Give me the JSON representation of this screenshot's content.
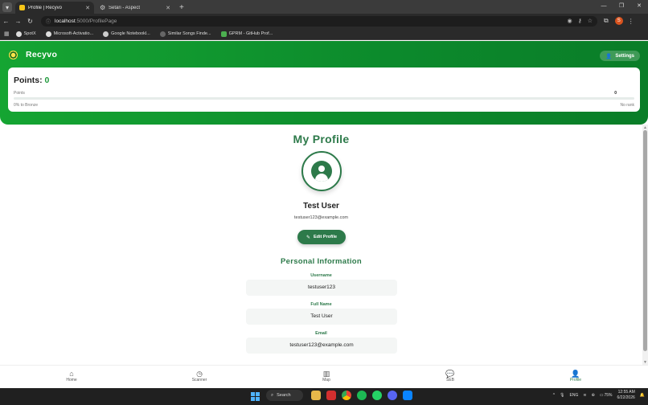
{
  "browser": {
    "tabs": [
      {
        "title": "Profile | Recyvo",
        "active": true
      },
      {
        "title": "Setári - Aspect",
        "active": false
      }
    ],
    "url_host": "localhost",
    "url_path": ":5000/ProfilePage",
    "bookmarks": [
      "SpotX",
      "Microsoft-Activatio...",
      "Google Notebookl...",
      "Similar Songs Finde...",
      "GPRM - GitHub Prof..."
    ],
    "profile_badge": "S"
  },
  "header": {
    "brand": "Recyvo",
    "settings_label": "Settings"
  },
  "points": {
    "title_label": "Points:",
    "value": "0",
    "row_label": "Points",
    "row_value": "0",
    "progress_fraction": 0,
    "progress_left": "0% to Bronze",
    "progress_right": "No rank"
  },
  "profile": {
    "page_title": "My Profile",
    "name": "Test User",
    "email": "testuser123@example.com",
    "edit_label": "Edit Profile"
  },
  "personal_info": {
    "title": "Personal Information",
    "fields": [
      {
        "label": "Username",
        "value": "testuser123"
      },
      {
        "label": "Full Name",
        "value": "Test User"
      },
      {
        "label": "Email",
        "value": "testuser123@example.com"
      }
    ]
  },
  "nav": {
    "items": [
      {
        "label": "Home",
        "icon": "home-icon"
      },
      {
        "label": "Scanner",
        "icon": "clock-icon"
      },
      {
        "label": "Map",
        "icon": "map-icon"
      },
      {
        "label": "SEB",
        "icon": "chat-icon"
      },
      {
        "label": "Profile",
        "icon": "person-icon",
        "active": true
      }
    ]
  },
  "taskbar": {
    "search_label": "Search",
    "lang": "ENG",
    "battery": "75%",
    "time": "12:55 AM",
    "date": "6/22/2026"
  },
  "colors": {
    "brand_green": "#15a532",
    "accent_green": "#2d7a4a"
  }
}
